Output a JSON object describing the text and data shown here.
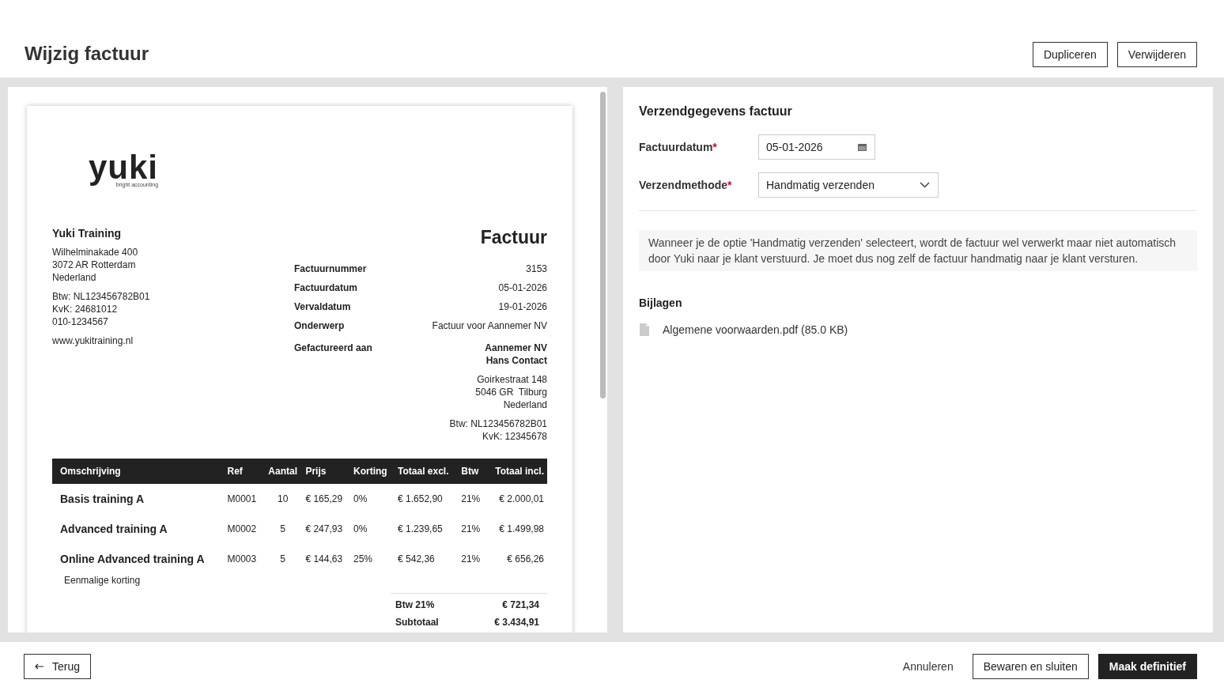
{
  "page": {
    "title": "Wijzig factuur",
    "actions": [
      "Dupliceren",
      "Verwijderen"
    ]
  },
  "invoice": {
    "logo": {
      "word": "yuki",
      "tagline": "bright accounting"
    },
    "company": {
      "name": "Yuki Training",
      "address": [
        "Wilhelminakade 400",
        "3072 AR Rotterdam",
        "Nederland"
      ],
      "ids": [
        "Btw: NL123456782B01",
        "KvK: 24681012",
        "010-1234567"
      ],
      "website": "www.yukitraining.nl"
    },
    "heading": "Factuur",
    "meta": [
      {
        "label": "Factuurnummer",
        "value": "3153"
      },
      {
        "label": "Factuurdatum",
        "value": "05-01-2026"
      },
      {
        "label": "Vervaldatum",
        "value": "19-01-2026"
      },
      {
        "label": "Onderwerp",
        "value": "Factuur voor Aannemer NV"
      }
    ],
    "billed_to": {
      "label": "Gefactureerd aan",
      "names": [
        "Aannemer NV",
        "Hans Contact"
      ],
      "address": [
        "Goirkestraat 148",
        "5046 GR  Tilburg",
        "Nederland"
      ],
      "ids": [
        "Btw: NL123456782B01",
        "KvK: 12345678"
      ]
    },
    "table": {
      "columns": [
        "Omschrijving",
        "Ref",
        "Aantal",
        "Prijs",
        "Korting",
        "Totaal excl.",
        "Btw",
        "Totaal incl."
      ],
      "rows": [
        {
          "cells": [
            "Basis training A",
            "M0001",
            "10",
            "€ 165,29",
            "0%",
            "€ 1.652,90",
            "21%",
            "€ 2.000,01"
          ]
        },
        {
          "cells": [
            "Advanced training A",
            "M0002",
            "5",
            "€ 247,93",
            "0%",
            "€ 1.239,65",
            "21%",
            "€ 1.499,98"
          ]
        },
        {
          "cells": [
            "Online Advanced training A",
            "M0003",
            "5",
            "€ 144,63",
            "25%",
            "€ 542,36",
            "21%",
            "€ 656,26"
          ],
          "note": "Eenmalige korting"
        }
      ]
    },
    "totals": [
      {
        "label": "Btw 21%",
        "value": "€ 721,34"
      },
      {
        "label": "Subtotaal",
        "value": "€ 3.434,91"
      }
    ]
  },
  "shipping": {
    "title": "Verzendgegevens factuur",
    "fields": [
      {
        "kind": "date",
        "label": "Factuurdatum",
        "required_mark": "*",
        "value": "05-01-2026"
      },
      {
        "kind": "select",
        "label": "Verzendmethode",
        "required_mark": "*",
        "value": "Handmatig verzenden"
      }
    ],
    "info": "Wanneer je de optie 'Handmatig verzenden' selecteert, wordt de factuur wel verwerkt maar niet automatisch door Yuki naar je klant verstuurd. Je moet dus nog zelf de factuur handmatig naar je klant versturen.",
    "attachments_title": "Bijlagen",
    "attachments": [
      "Algemene voorwaarden.pdf (85.0 KB)"
    ]
  },
  "footer": {
    "back": "Terug",
    "cancel": "Annuleren",
    "save": "Bewaren en sluiten",
    "finalize": "Maak definitief"
  }
}
